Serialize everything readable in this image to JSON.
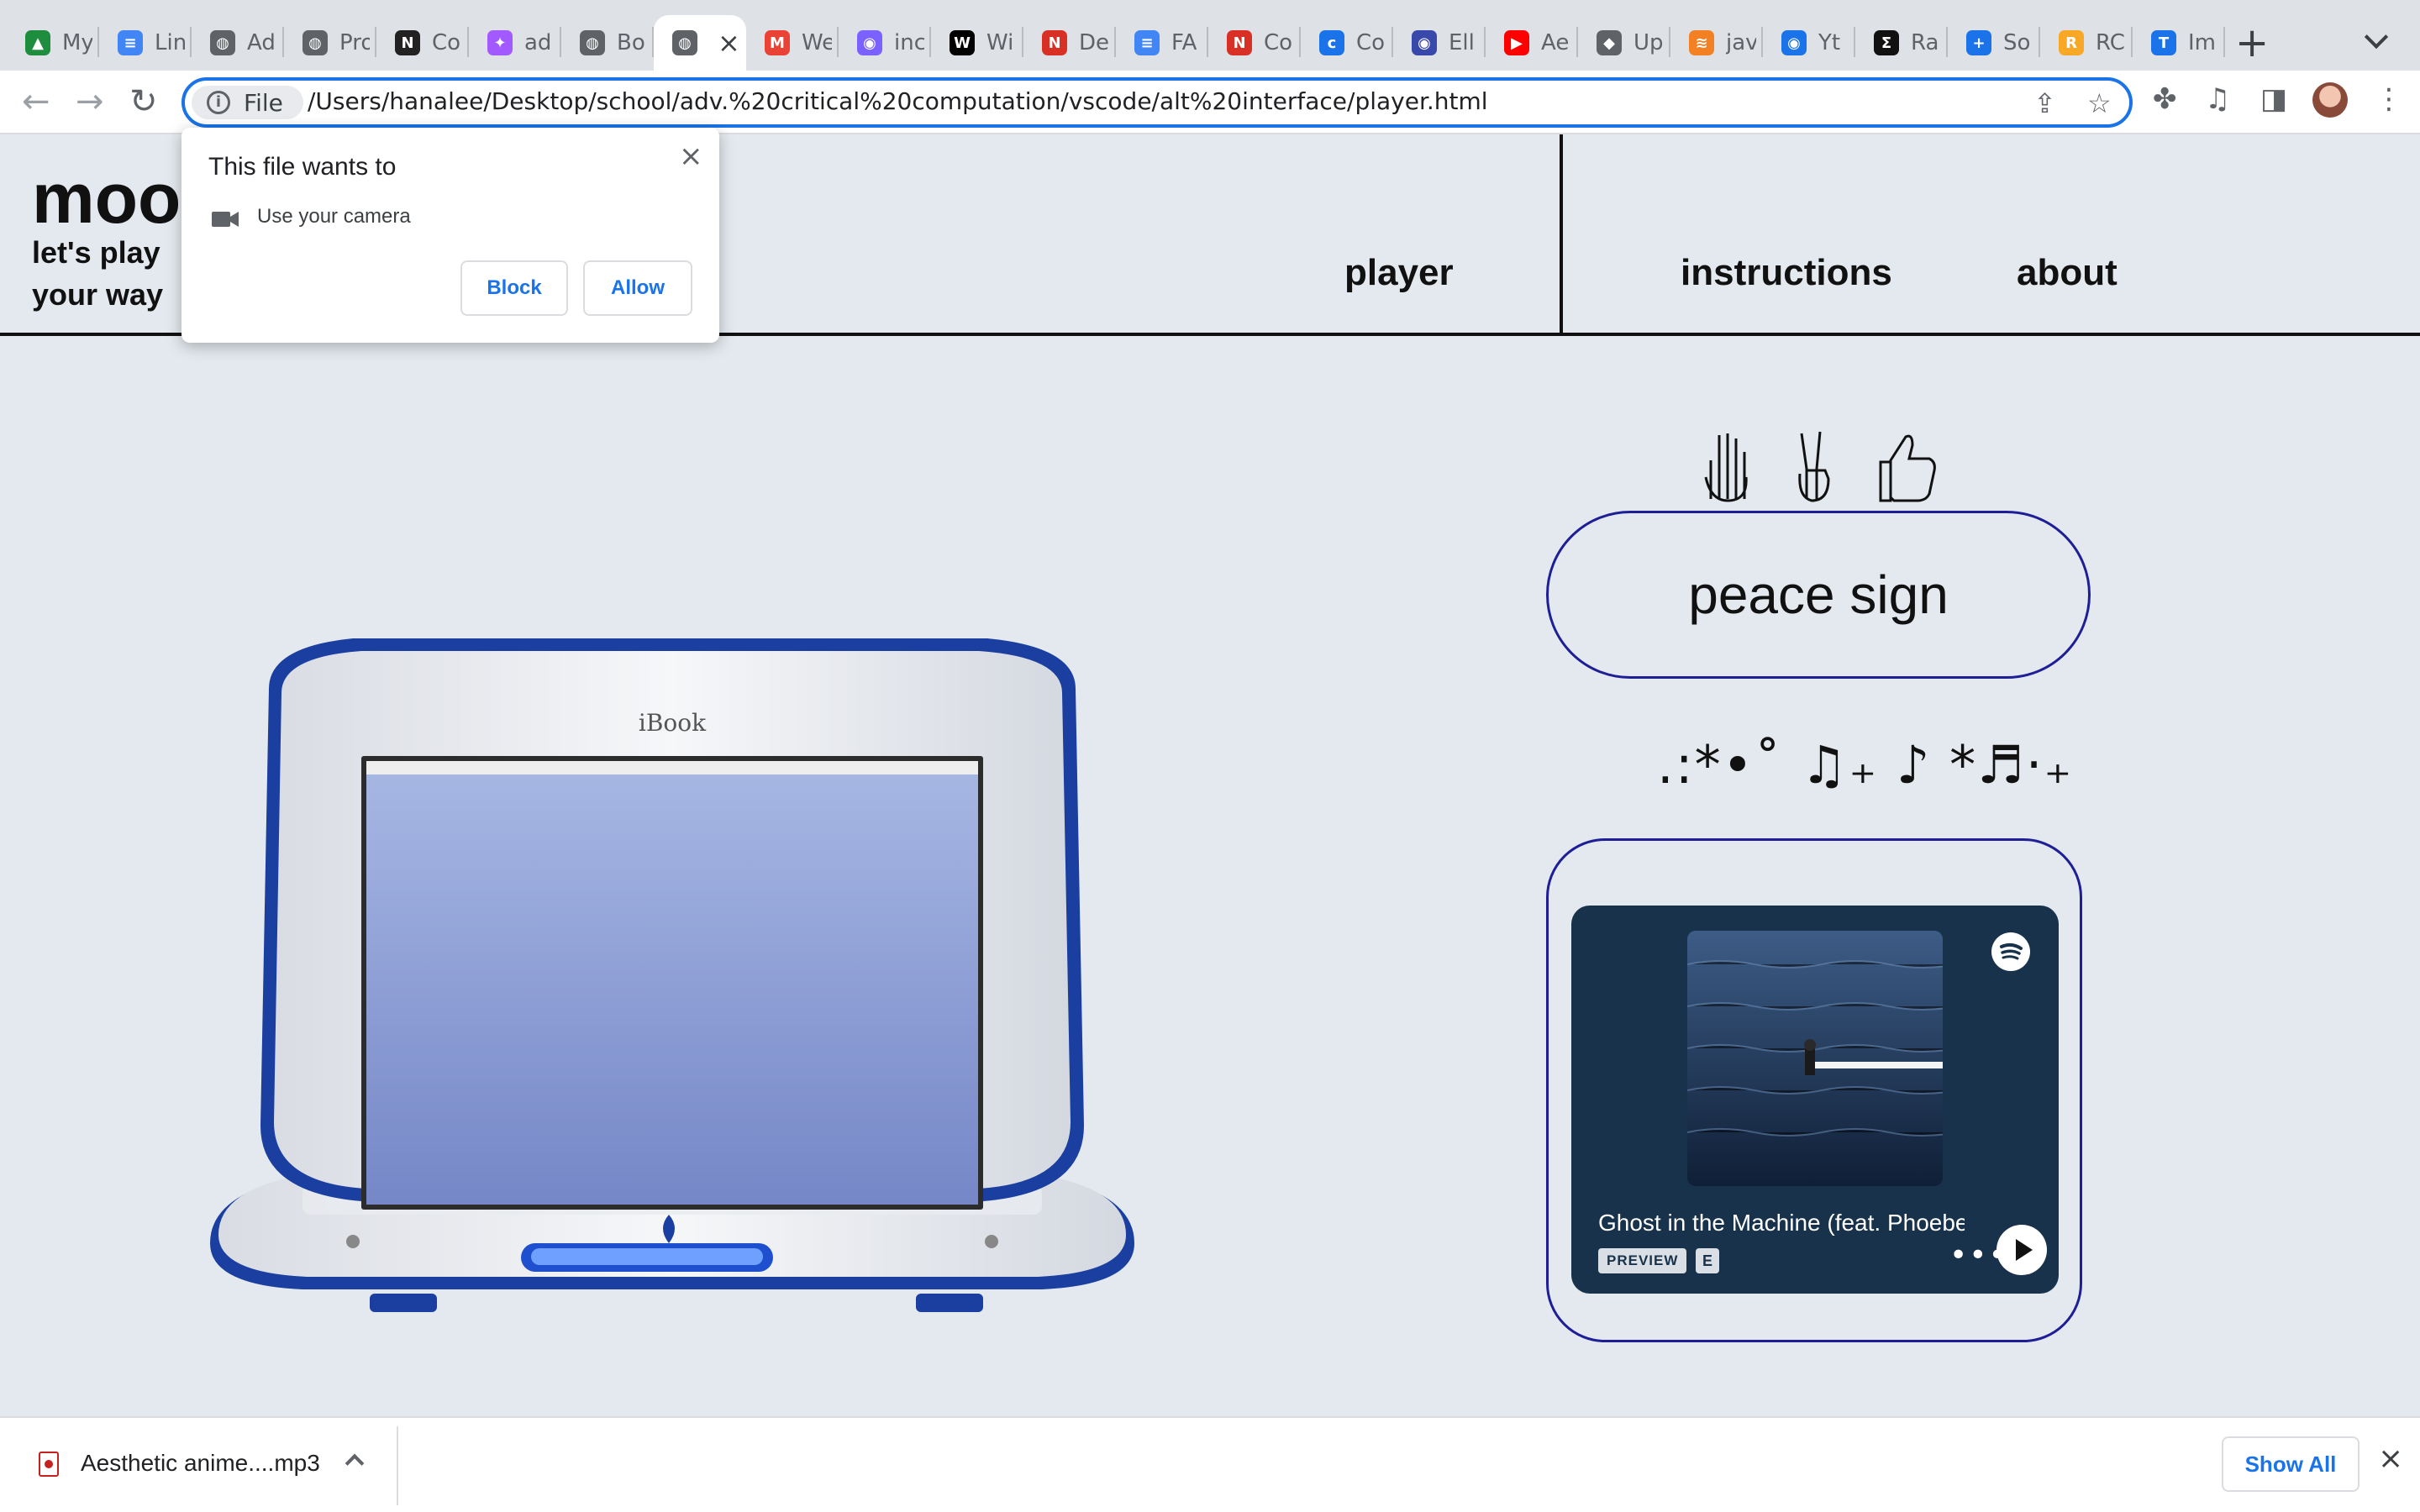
{
  "browser": {
    "tabs": [
      {
        "title": "My",
        "icon": "google-drive-icon",
        "color": "#1e8e3e"
      },
      {
        "title": "Lin",
        "icon": "google-docs-icon",
        "color": "#4285f4"
      },
      {
        "title": "Ad",
        "icon": "globe-icon",
        "color": "#5f6368"
      },
      {
        "title": "Pro",
        "icon": "globe-icon",
        "color": "#5f6368"
      },
      {
        "title": "Co",
        "icon": "notion-icon",
        "color": "#222222"
      },
      {
        "title": "ad",
        "icon": "figma-icon",
        "color": "#a259ff"
      },
      {
        "title": "Bo",
        "icon": "globe-icon",
        "color": "#5f6368"
      },
      {
        "title": "",
        "icon": "globe-icon",
        "color": "#5f6368",
        "active": true
      },
      {
        "title": "We",
        "icon": "gmail-icon",
        "color": "#ea4335"
      },
      {
        "title": "inc",
        "icon": "app-icon",
        "color": "#7b61ff"
      },
      {
        "title": "Wi",
        "icon": "wix-icon",
        "color": "#000000"
      },
      {
        "title": "De",
        "icon": "n-icon",
        "color": "#d93025"
      },
      {
        "title": "FA",
        "icon": "google-docs-icon",
        "color": "#4285f4"
      },
      {
        "title": "Co",
        "icon": "n-icon",
        "color": "#d93025"
      },
      {
        "title": "Co",
        "icon": "c-icon",
        "color": "#1a73e8"
      },
      {
        "title": "Ell",
        "icon": "app-icon",
        "color": "#3949ab"
      },
      {
        "title": "Ae",
        "icon": "youtube-icon",
        "color": "#ff0000"
      },
      {
        "title": "Up",
        "icon": "cap-icon",
        "color": "#5f6368"
      },
      {
        "title": "jav",
        "icon": "stack-icon",
        "color": "#f48024"
      },
      {
        "title": "Yt",
        "icon": "app-icon",
        "color": "#1a73e8"
      },
      {
        "title": "Ra",
        "icon": "sigma-icon",
        "color": "#111111"
      },
      {
        "title": "So",
        "icon": "plus-icon",
        "color": "#1a73e8"
      },
      {
        "title": "RC",
        "icon": "r-icon",
        "color": "#f9a825"
      },
      {
        "title": "Im",
        "icon": "tm-icon",
        "color": "#1a73e8"
      }
    ],
    "address": {
      "chip": "File",
      "url": "/Users/hanalee/Desktop/school/adv.%20critical%20computation/vscode/alt%20interface/player.html"
    }
  },
  "permission_popup": {
    "title": "This file wants to",
    "permission": "Use your camera",
    "block_label": "Block",
    "allow_label": "Allow"
  },
  "site": {
    "logo": "mood",
    "tagline_line1": "let's play",
    "tagline_line2": "your way",
    "nav": {
      "player": "player",
      "instructions": "instructions",
      "about": "about"
    }
  },
  "device_label": "iBook",
  "gesture": {
    "icons": [
      "raised-hand-icon",
      "peace-sign-icon",
      "thumbs-up-icon"
    ],
    "current": "peace sign"
  },
  "music_glyphs": ".:*•˚ ♫₊ ♪ *♬·₊",
  "spotify": {
    "track": "Ghost in the Machine (feat. Phoebe Bridgers)",
    "preview_badge": "PREVIEW",
    "explicit_badge": "E",
    "accent": "#18324b"
  },
  "downloads": {
    "file": "Aesthetic anime....mp3",
    "show_all": "Show All"
  }
}
